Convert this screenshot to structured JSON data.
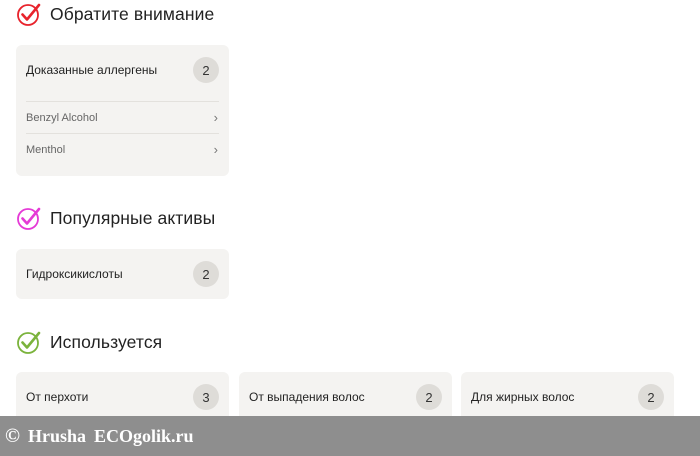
{
  "sections": {
    "attention": {
      "title": "Обратите внимание",
      "icon_color": "#e8232c",
      "card": {
        "label": "Доказанные аллергены",
        "count": "2",
        "items": [
          "Benzyl Alcohol",
          "Menthol"
        ]
      }
    },
    "popular": {
      "title": "Популярные активы",
      "icon_color": "#e53ad6",
      "card": {
        "label": "Гидроксикислоты",
        "count": "2"
      }
    },
    "used": {
      "title": "Используется",
      "icon_color": "#7bb33c",
      "cards": [
        {
          "label": "От перхоти",
          "count": "3"
        },
        {
          "label": "От выпадения волос",
          "count": "2"
        },
        {
          "label": "Для жирных волос",
          "count": "2"
        }
      ]
    }
  },
  "watermark": {
    "symbol": "©",
    "author": "Hrusha",
    "site": "ECOgolik.ru"
  }
}
